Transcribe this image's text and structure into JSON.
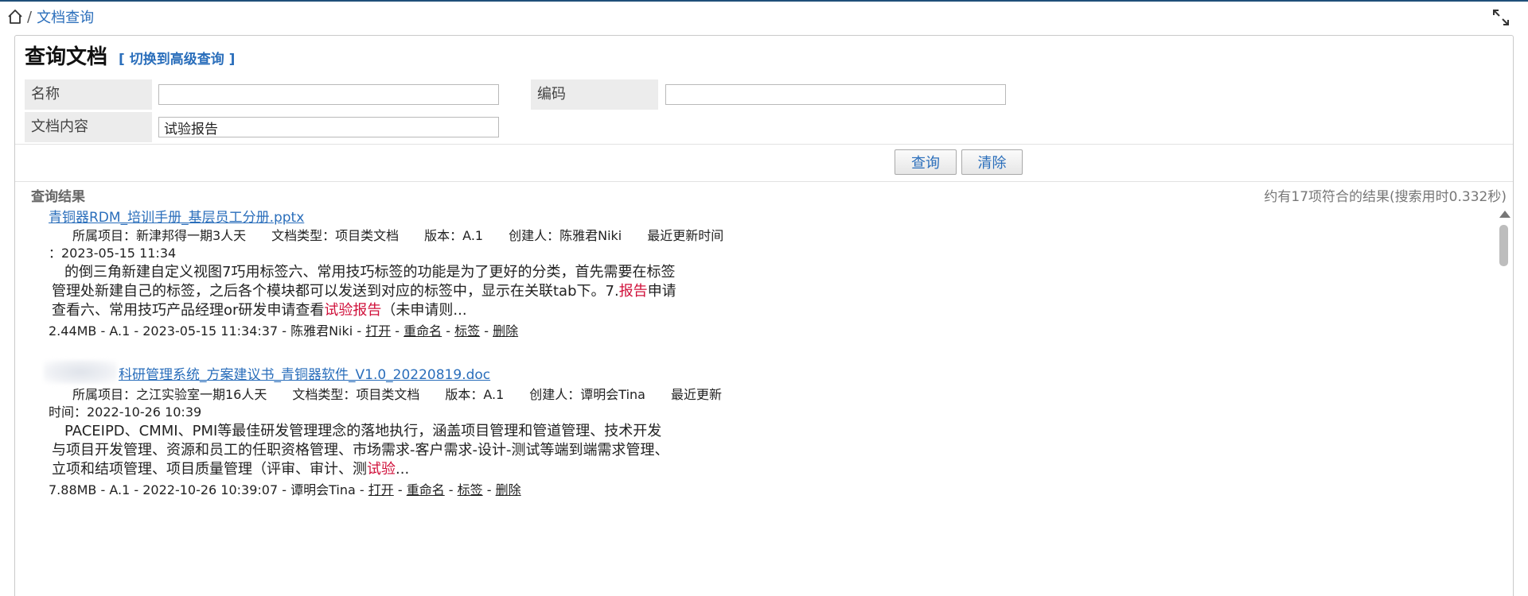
{
  "breadcrumb": {
    "separator": "/",
    "current": "文档查询"
  },
  "page_title": "查询文档",
  "switch_link": "[ 切换到高级查询 ]",
  "form": {
    "name_label": "名称",
    "name_value": "",
    "code_label": "编码",
    "code_value": "",
    "content_label": "文档内容",
    "content_value": "试验报告"
  },
  "buttons": {
    "search": "查询",
    "clear": "清除"
  },
  "results": {
    "label": "查询结果",
    "count_text": "约有17项符合的结果(搜索用时0.332秒)",
    "items": [
      {
        "title": "青铜器RDM_培训手册_基层员工分册.pptx",
        "meta_line1": "所属项目：新津邦得一期3人天　　文档类型：项目类文档　　版本：A.1　　创建人：陈雅君Niki　　最近更新时间",
        "meta_line2": "：2023-05-15 11:34",
        "snippet": {
          "part1": "的倒三角新建自定义视图7巧用标签六、常用技巧标签的功能是为了更好的分类，首先需要在标签",
          "part2": "管理处新建自己的标签，之后各个模块都可以发送到对应的标签中，显示在关联tab下。7.",
          "hl1": "报告",
          "part3": "申请",
          "part4": "查看六、常用技巧产品经理or研发申请查看",
          "hl2": "试验报告",
          "part5": "（未申请则..."
        },
        "footer": {
          "info": "2.44MB  - A.1  - 2023-05-15 11:34:37  - 陈雅君Niki - ",
          "open": "打开",
          "rename": "重命名",
          "tag": "标签",
          "delete": "删除",
          "dash": " - "
        }
      },
      {
        "title": "科研管理系统_方案建议书_青铜器软件_V1.0_20220819.doc",
        "meta_line1": "所属项目：之江实验室一期16人天　　文档类型：项目类文档　　版本：A.1　　创建人：谭明会Tina　　最近更新",
        "meta_line2": "时间：2022-10-26 10:39",
        "snippet": {
          "part1": "PACEIPD、CMMI、PMI等最佳研发管理理念的落地执行，涵盖项目管理和管道管理、技术开发",
          "part2": "与项目开发管理、资源和员工的任职资格管理、市场需求-客户需求-设计-测试等端到端需求管理、",
          "part3": "立项和结项管理、项目质量管理（评审、审计、测",
          "hl1": "试验",
          "part4": "..."
        },
        "footer": {
          "info": "7.88MB  - A.1  - 2022-10-26 10:39:07  - 谭明会Tina - ",
          "open": "打开",
          "rename": "重命名",
          "tag": "标签",
          "delete": "删除",
          "dash": " - "
        }
      }
    ]
  },
  "icons": {
    "home": "home-icon",
    "expand": "expand-icon"
  },
  "colors": {
    "link": "#2a6ebb",
    "highlight": "#d0103a",
    "label_bg": "#ececec"
  }
}
